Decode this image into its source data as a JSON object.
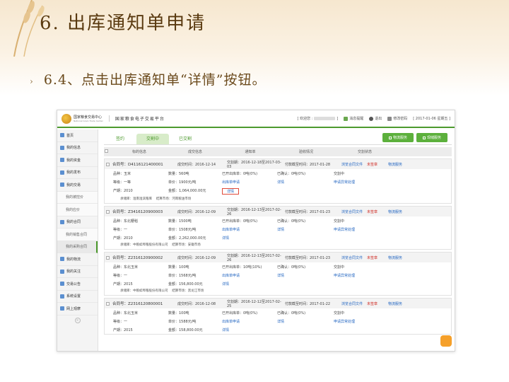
{
  "slide": {
    "title": "6. 出库通知单申请",
    "subtitle": "6.4、点击出库通知单“详情”按钮。"
  },
  "app": {
    "logo_cn": "国家粮食交易中心",
    "logo_en": "National Grain Trade Center",
    "platform": "国家粮食电子交易平台",
    "welcome": "[ 欢迎您 :",
    "welcome_end": "]",
    "msg": "消息提醒",
    "exit": "退出",
    "change_pwd": "修改密码",
    "date": "[ 2017-01-06 星期五 ]"
  },
  "sidebar": {
    "items": [
      {
        "label": "首页",
        "type": "main"
      },
      {
        "label": "我的信息",
        "type": "main"
      },
      {
        "label": "我的资金",
        "type": "main"
      },
      {
        "label": "我的发布",
        "type": "main"
      },
      {
        "label": "我的交易",
        "type": "main"
      },
      {
        "label": "我的被控价",
        "type": "sub"
      },
      {
        "label": "我的应价",
        "type": "sub"
      },
      {
        "label": "我的合同",
        "type": "main"
      },
      {
        "label": "我的销售合同",
        "type": "sub"
      },
      {
        "label": "我的采购合同",
        "type": "sub-active"
      },
      {
        "label": "我的物流",
        "type": "main"
      },
      {
        "label": "我的关注",
        "type": "main"
      },
      {
        "label": "交易公告",
        "type": "main"
      },
      {
        "label": "系统设置",
        "type": "main"
      },
      {
        "label": "网上观摩",
        "type": "main"
      }
    ],
    "collapse": "«"
  },
  "tabs": [
    "签约",
    "交割中",
    "已交割"
  ],
  "buttons": {
    "logistics": "物流服务",
    "stock": "现储服务"
  },
  "table_headers": [
    "标的信息",
    "成交信息",
    "通知单",
    "验收情况",
    "交割状态"
  ],
  "orders": [
    {
      "no": "合同号：D4116121400001",
      "deal_time": "成交时间：2016-12-14",
      "span": "交割期：2016-12-18至2017-03-03",
      "pay": "付款截至时间：2017-01-28",
      "contract": "浏览合同文件",
      "unsigned": "未签章",
      "logistic": "物流服务",
      "product": "品种：玉米",
      "grade": "等级：一等",
      "year": "产期：2010",
      "qty": "数量：560吨",
      "price": "单价：1900元/吨",
      "amount": "金额：1,064,000.00元",
      "out_qty": "已开出库单：0吨(0%)",
      "notice_link": "出库单申请",
      "detail": "详情",
      "accept": "已确认：0吨(0%)",
      "accept_detail": "详情",
      "status": "交割中",
      "status_link": "申请异常处理",
      "depot": "承储库：淮南淮滨粮库",
      "market": "结算市场：河南粮油市场"
    },
    {
      "no": "合同号：Z3416120900003",
      "deal_time": "成交时间：2016-12-09",
      "span": "交割期：2016-12-13至2017-02-26",
      "pay": "付款截至时间：2017-01-23",
      "contract": "浏览合同文件",
      "unsigned": "未签章",
      "logistic": "物流服务",
      "product": "品种：东北粳稻",
      "grade": "等级：一",
      "year": "产期：2010",
      "qty": "数量：1500吨",
      "price": "单价：1508元/吨",
      "amount": "金额：2,262,000.00元",
      "out_qty": "已开出库单：0吨(0%)",
      "notice_link": "出库单申请",
      "detail": "详情",
      "accept": "已确认：0吨(0%)",
      "accept_detail": "详情",
      "status": "交割中",
      "status_link": "申请异常处理",
      "depot": "承储库：中粮蚌埠粮股份有限公司",
      "market": "结算市场：安徽市场"
    },
    {
      "no": "合同号：Z2316120900002",
      "deal_time": "成交时间：2016-12-09",
      "span": "交割期：2016-12-13至2017-02-26",
      "pay": "付款截至时间：2017-01-23",
      "contract": "浏览合同文件",
      "unsigned": "未签章",
      "logistic": "物流服务",
      "product": "品种：东北玉米",
      "grade": "等级：一",
      "year": "产期：2015",
      "qty": "数量：100吨",
      "price": "单价：1568元/吨",
      "amount": "金额：156,800.00元",
      "out_qty": "已开出库单：10吨(10%)",
      "notice_link": "出库单申请",
      "detail": "详情",
      "accept": "已确认：0吨(0%)",
      "accept_detail": "详情",
      "status": "交割中",
      "status_link": "申请异常处理",
      "depot": "承储库：中粮蚌埠粮股份有限公司",
      "market": "结算市场：黑龙江市场"
    },
    {
      "no": "合同号：Z2316120800001",
      "deal_time": "成交时间：2016-12-08",
      "span": "交割期：2016-12-12至2017-02-25",
      "pay": "付款截至时间：2017-01-22",
      "contract": "浏览合同文件",
      "unsigned": "未签章",
      "logistic": "物流服务",
      "product": "品种：东北玉米",
      "grade": "等级：一",
      "year": "产期：2015",
      "qty": "数量：100吨",
      "price": "单价：1588元/吨",
      "amount": "金额：158,800.00元",
      "out_qty": "已开出库单：0吨(0%)",
      "notice_link": "出库单申请",
      "detail": "详情",
      "accept": "已确认：0吨(0%)",
      "accept_detail": "详情",
      "status": "交割中",
      "status_link": "申请异常处理"
    }
  ],
  "colors": {
    "accent_green": "#4d9a2e",
    "link_blue": "#1f63c0",
    "unsigned_red": "#d0322b",
    "highlight_box": "#e04a3a"
  }
}
